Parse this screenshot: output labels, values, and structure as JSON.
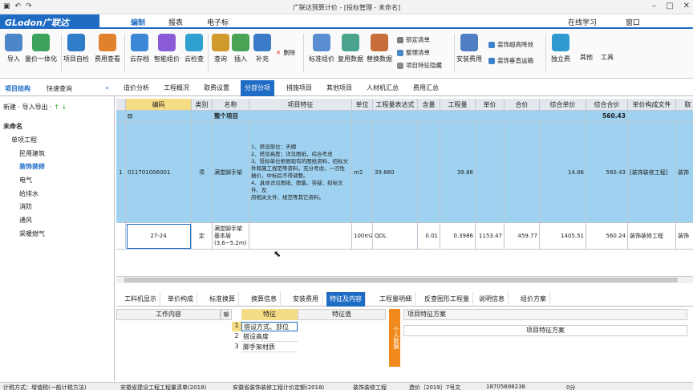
{
  "window": {
    "title": "广联达预算计价 - [投标管理 - 未命名]"
  },
  "menubar": {
    "logo": "GLodon广联达",
    "items": [
      "编制",
      "报表",
      "电子标"
    ],
    "online_learning": "在线学习",
    "window_menu": "窗口"
  },
  "ribbon": {
    "buttons": [
      "导入",
      "量价一体化",
      "项目自检",
      "费用查看",
      "云存档",
      "智能组价",
      "云检查",
      "查询",
      "插入",
      "补充",
      "删除",
      "标准组价",
      "复用数据",
      "替换数据",
      "安装费用",
      "独立费",
      "其他",
      "工具"
    ],
    "small": [
      "锁定清单",
      "整理清单",
      "项目特征隐藏",
      "装饰超高降效",
      "装饰垂直运输"
    ]
  },
  "left_panel": {
    "tabs": [
      "项目结构",
      "快速查询"
    ],
    "toolbar": "新建 · 导入导出 ·",
    "tree": [
      "未命名",
      "单项工程",
      "民用建筑",
      "装饰装修",
      "电气",
      "给排水",
      "消防",
      "通风",
      "采暖燃气"
    ]
  },
  "main_tabs": [
    "造价分析",
    "工程概况",
    "取费设置",
    "分部分项",
    "措施项目",
    "其他项目",
    "人材机汇总",
    "费用汇总"
  ],
  "grid": {
    "columns": [
      "编码",
      "类别",
      "名称",
      "项目特征",
      "单位",
      "工程量表达式",
      "含量",
      "工程量",
      "单价",
      "合价",
      "综合单价",
      "综合合价",
      "单价构成文件",
      "取"
    ],
    "total_row": {
      "name": "整个项目",
      "amount": "560.43"
    },
    "rows": [
      {
        "seq": "1",
        "code": "011701006001",
        "type": "项",
        "name": "满堂脚手架",
        "feature": "1、搭设部位：天棚\n2、搭设高度：详见图纸，综合考虑\n3、投标单位根据现有的图纸资料、招标文件和施工规范等资料，充分考虑，一次性报价，中标后不得调整。\n4、具体详见图纸、图集、答疑、招标文件、及\n府相关文件、规范等其它资料。",
        "unit": "m2",
        "expr": "39.860",
        "content": "",
        "qty": "39.86",
        "price": "",
        "total": "",
        "comp_price": "14.06",
        "comp_total": "560.43",
        "file": "[装饰装修工程]",
        "fee": "装饰"
      },
      {
        "seq": "",
        "code": "27-24",
        "type": "定",
        "name": "满堂脚手架 基本层(3.6~5.2m)",
        "feature": "",
        "unit": "100m2",
        "expr": "QDL",
        "content": "0.01",
        "qty": "0.3986",
        "price": "1153.47",
        "total": "459.77",
        "comp_price": "1405.51",
        "comp_total": "560.24",
        "file": "装饰装修工程",
        "fee": "装饰"
      }
    ]
  },
  "bottom_tabs": [
    "工料机显示",
    "单价构成",
    "标准换算",
    "换算信息",
    "安装费用",
    "特征及内容",
    "工程量明细",
    "反查图形工程量",
    "说明信息",
    "组价方案"
  ],
  "bottom": {
    "work_header": "工作内容",
    "feature_header": "特征",
    "value_header": "特征值",
    "features": [
      "搭设方式、部位",
      "搭设高度",
      "脚手架材质"
    ],
    "side_label": "个人数据",
    "scheme_title": "项目特征方案",
    "scheme_col": "项目特征方案"
  },
  "statusbar": [
    "计税方式：增值税(一般计税方法)",
    "安徽省建设工程工程量清单(2018)",
    "安徽省装饰装修工程计价定额(2018)",
    "装饰装修工程",
    "造价〔2019〕7号文",
    "18705698238",
    "0分"
  ]
}
